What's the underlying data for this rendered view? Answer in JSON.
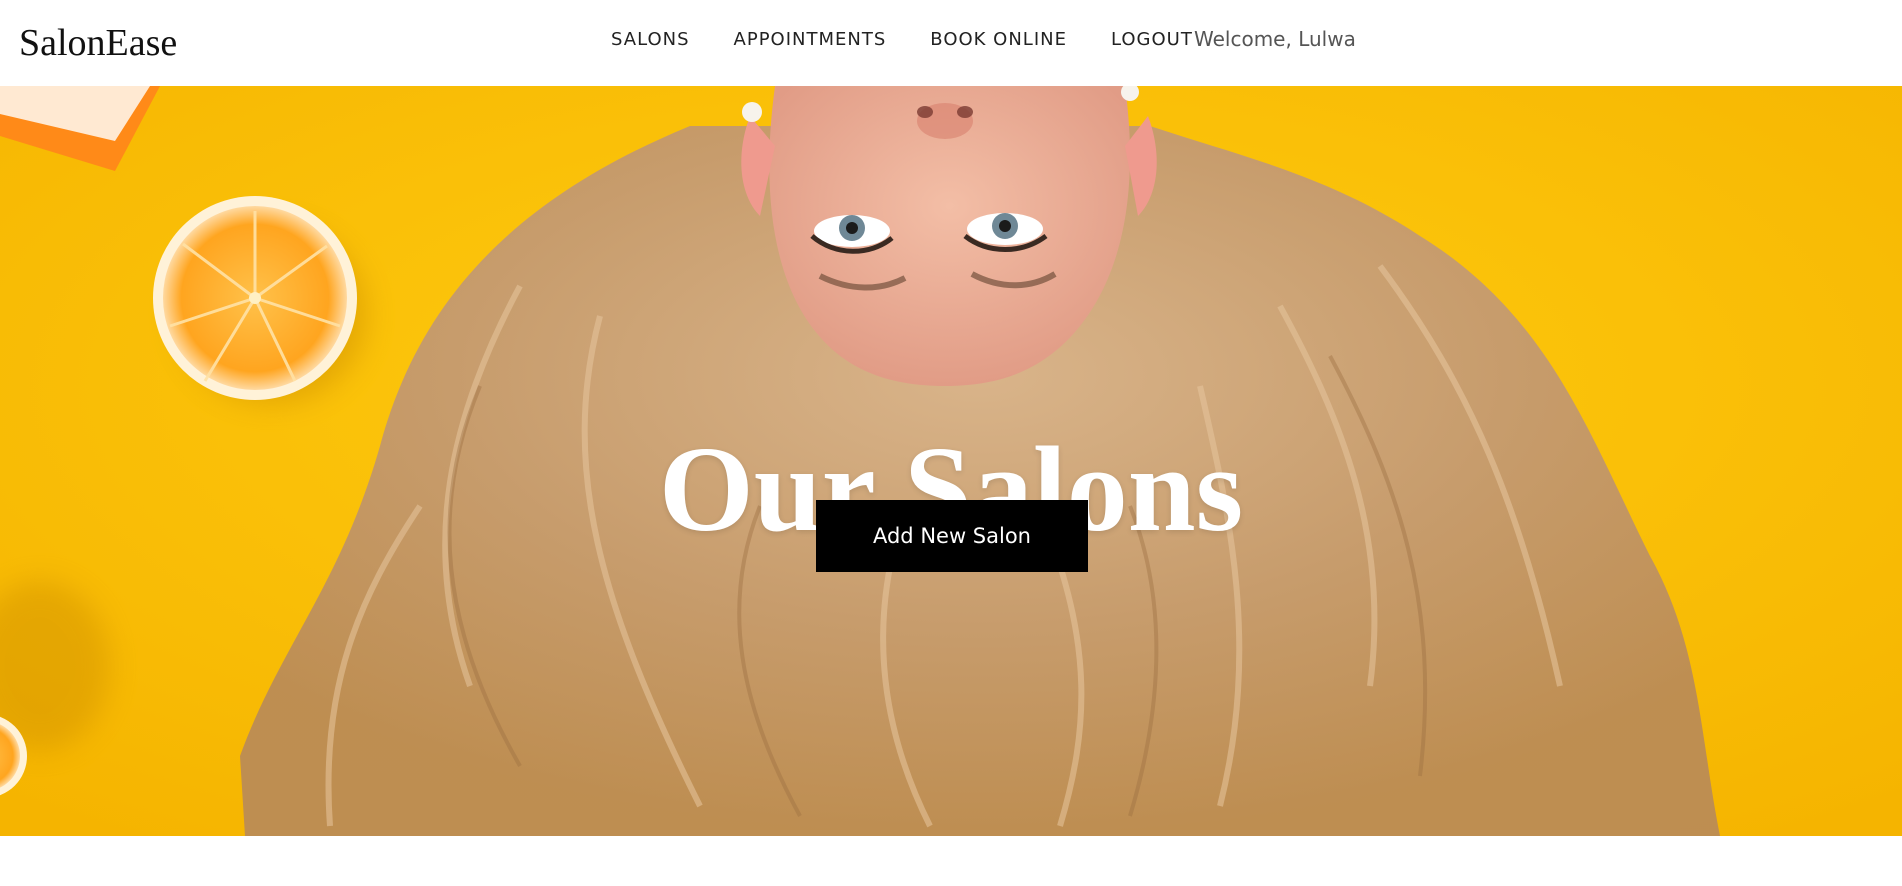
{
  "brand": {
    "name": "SalonEase"
  },
  "nav": {
    "items": [
      {
        "label": "SALONS"
      },
      {
        "label": "APPOINTMENTS"
      },
      {
        "label": "BOOK ONLINE"
      },
      {
        "label": "LOGOUT"
      }
    ],
    "welcome": "Welcome, Lulwa"
  },
  "hero": {
    "title": "Our Salons",
    "button_label": "Add New Salon",
    "image": "woman-upside-down-blonde-hair-yellow-background-oranges"
  },
  "colors": {
    "hero_background": "#ffc400",
    "button_background": "#000000",
    "button_text": "#ffffff",
    "hero_title": "#ffffff",
    "nav_text": "#222222"
  }
}
